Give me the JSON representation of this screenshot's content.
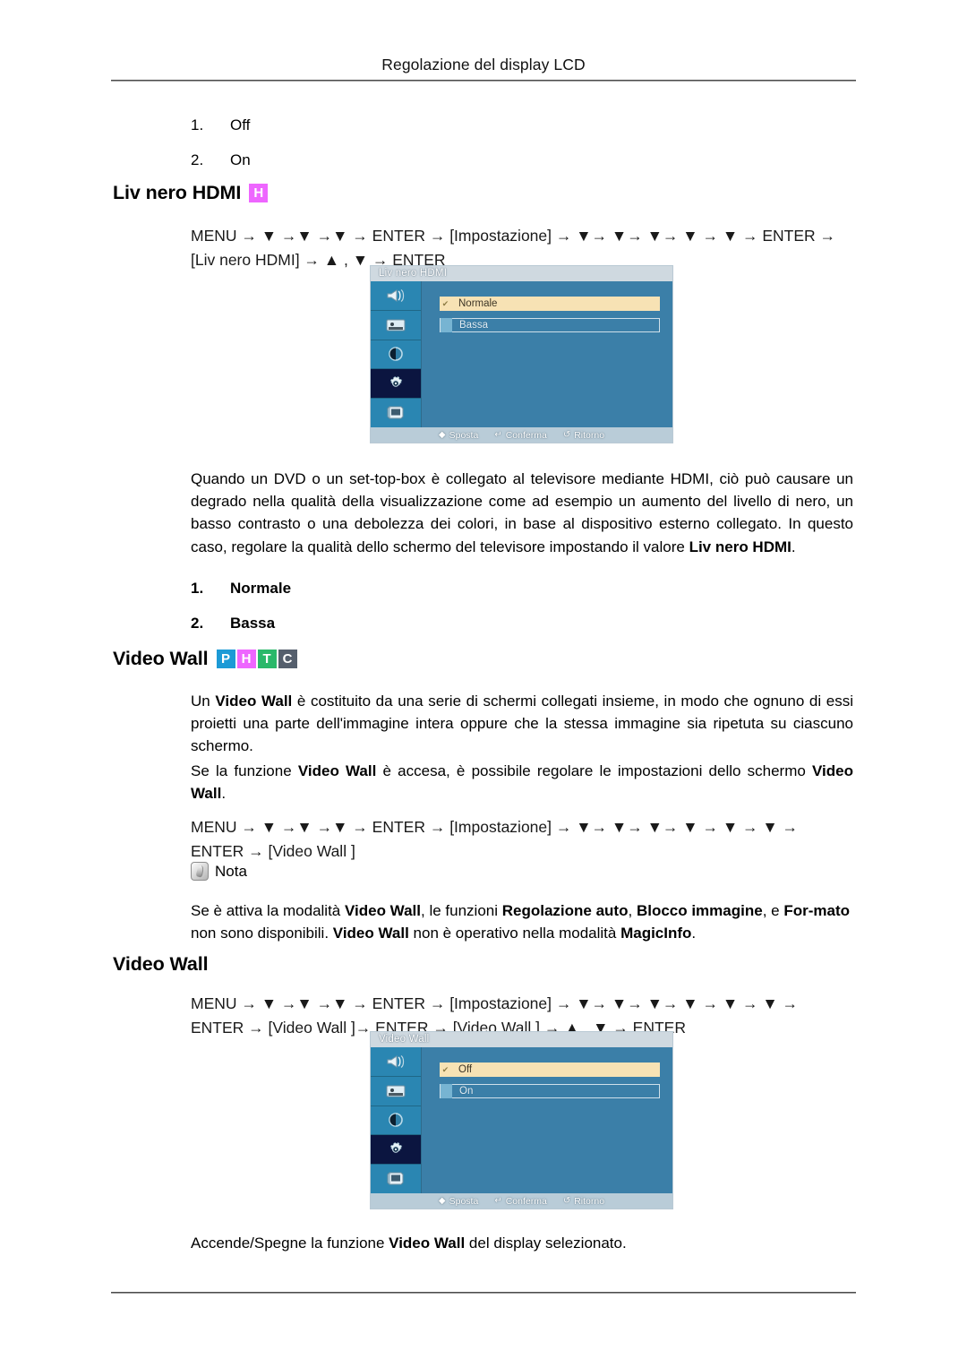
{
  "page": {
    "header": "Regolazione del display LCD"
  },
  "top_list": {
    "items": [
      {
        "num": "1.",
        "label": "Off"
      },
      {
        "num": "2.",
        "label": "On"
      }
    ]
  },
  "section_hdmi": {
    "title": "Liv nero HDMI",
    "badges": [
      {
        "letter": "H",
        "color": "#ee66ff"
      }
    ],
    "path_line1_pre": "MENU",
    "path": "MENU → ▼ →▼ →▼ → ENTER → [Impostazione] → ▼→ ▼→ ▼→ ▼ → ▼ → ENTER → [Liv nero HDMI] → ▲ , ▼ → ENTER",
    "paragraph_plain": "Quando un DVD o un set-top-box è collegato al televisore mediante HDMI, ciò può causare un degrado nella qualità della visualizzazione come ad esempio un aumento del livello di nero, un basso contrasto o una debolezza dei colori, in base al dispositivo esterno collegato. In questo caso, regolare la qualità dello schermo del televisore impostando il valore ",
    "paragraph_bold": "Liv nero HDMI",
    "paragraph_tail": ".",
    "options": [
      {
        "num": "1.",
        "label": "Normale"
      },
      {
        "num": "2.",
        "label": "Bassa"
      }
    ]
  },
  "osd_hdmi": {
    "title": "Liv nero HDMI",
    "rows": [
      {
        "label": "Normale",
        "state": "active",
        "check": "✔"
      },
      {
        "label": "Bassa",
        "state": "plain",
        "check": ""
      }
    ],
    "footer": [
      {
        "glyph": "◆",
        "label": "Sposta"
      },
      {
        "glyph": "↵",
        "label": "Conferma"
      },
      {
        "glyph": "↺",
        "label": "Ritorno"
      }
    ],
    "rail_icons": [
      "speaker-icon",
      "picture-icon",
      "contrast-icon",
      "gear-icon",
      "monitor-icon"
    ],
    "rail_selected_index": 3
  },
  "section_videowall": {
    "title": "Video Wall",
    "badges": [
      {
        "letter": "P",
        "color": "#1d9ad6"
      },
      {
        "letter": "H",
        "color": "#ee66ff"
      },
      {
        "letter": "T",
        "color": "#2ab86a"
      },
      {
        "letter": "C",
        "color": "#555f6d"
      }
    ],
    "p1_a": "Un ",
    "p1_b1": "Video Wall",
    "p1_c": " è costituito da una serie di schermi collegati insieme, in modo che ognuno di essi proietti una parte dell'immagine intera oppure che la stessa immagine sia ripetuta su ciascuno schermo.",
    "p2_a": "Se la funzione ",
    "p2_b1": "Video Wall",
    "p2_c": " è accesa, è possibile regolare le impostazioni dello schermo ",
    "p2_b2": "Video Wall",
    "p2_d": ".",
    "path": "MENU → ▼ →▼ →▼ → ENTER → [Impostazione] → ▼→ ▼→ ▼→ ▼ → ▼ → ▼ → ENTER → [Video Wall ]"
  },
  "nota": {
    "label": "Nota",
    "body_a": "Se è attiva la modalità ",
    "body_b1": "Video Wall",
    "body_c": ", le funzioni ",
    "body_b2": "Regolazione auto",
    "body_d": ", ",
    "body_b3": "Blocco immagine",
    "body_e": ", e ",
    "body_b4": "For-mato",
    "body_f": " non sono disponibili. ",
    "body_b5": "Video Wall",
    "body_g": " non è operativo nella modalità ",
    "body_b6": "MagicInfo",
    "body_h": "."
  },
  "section_videowall2": {
    "title": "Video Wall",
    "path": "MENU → ▼ →▼ →▼ → ENTER → [Impostazione] → ▼→ ▼→ ▼→ ▼ → ▼ → ▼ → ENTER → [Video Wall ]→ ENTER → [Video Wall ] → ▲ , ▼ → ENTER",
    "caption_a": "Accende/Spegne la funzione ",
    "caption_b": "Video Wall",
    "caption_c": " del display selezionato."
  },
  "osd_videowall": {
    "title": "Video Wall",
    "rows": [
      {
        "label": "Off",
        "state": "active",
        "check": "✔"
      },
      {
        "label": "On",
        "state": "plain",
        "check": ""
      }
    ],
    "footer": [
      {
        "glyph": "◆",
        "label": "Sposta"
      },
      {
        "glyph": "↵",
        "label": "Conferma"
      },
      {
        "glyph": "↺",
        "label": "Ritorno"
      }
    ],
    "rail_icons": [
      "speaker-icon",
      "picture-icon",
      "contrast-icon",
      "gear-icon",
      "monitor-icon"
    ],
    "rail_selected_index": 3
  }
}
